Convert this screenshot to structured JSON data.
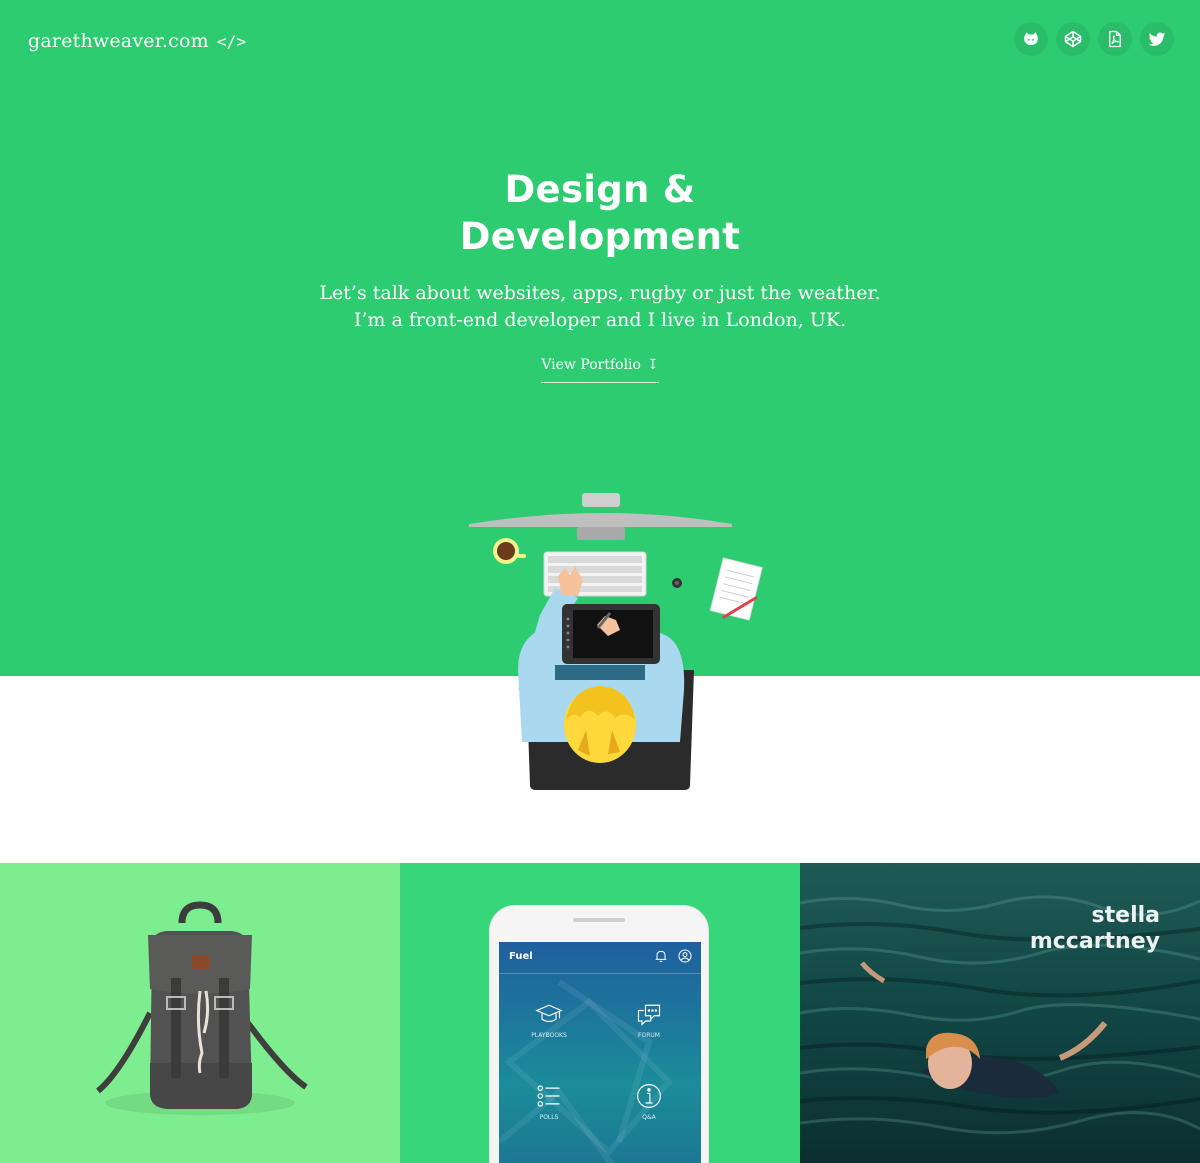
{
  "site": {
    "brand": "garethweaver.com",
    "brand_icon": "</>"
  },
  "socials": [
    {
      "name": "github-icon",
      "label": "GitHub"
    },
    {
      "name": "codepen-icon",
      "label": "CodePen"
    },
    {
      "name": "pdf-icon",
      "label": "CV PDF"
    },
    {
      "name": "twitter-icon",
      "label": "Twitter"
    }
  ],
  "hero": {
    "title_line1": "Design &",
    "title_line2": "Development",
    "subtitle_line1": "Let’s talk about websites, apps, rugby or just the weather.",
    "subtitle_line2": "I’m a front-end developer and I live in London, UK.",
    "cta": "View Portfolio",
    "cta_icon": "↧"
  },
  "portfolio": {
    "app": {
      "title": "Fuel",
      "menu": [
        "PLAYBOOKS",
        "FORUM",
        "POLLS",
        "Q&A"
      ]
    },
    "stella": {
      "line1": "stella",
      "line2": "mccartney"
    }
  },
  "colors": {
    "hero_bg": "#2ecc71",
    "tile1_bg": "#7eed8f",
    "tile2_bg": "#37d67a",
    "text": "#ffffff"
  }
}
